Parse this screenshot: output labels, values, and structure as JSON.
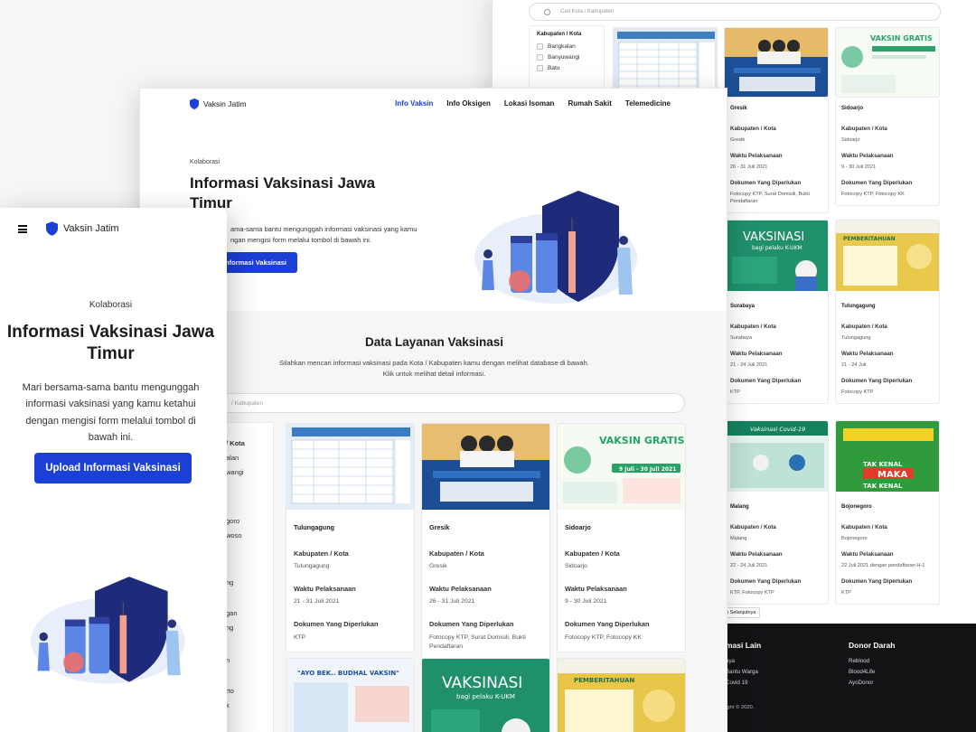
{
  "brand": {
    "name": "Vaksin Jatim",
    "color": "#1c3fd6"
  },
  "nav": {
    "items": [
      {
        "label": "Info Vaksin",
        "active": true
      },
      {
        "label": "Info Oksigen",
        "active": false
      },
      {
        "label": "Lokasi Isoman",
        "active": false
      },
      {
        "label": "Rumah Sakit",
        "active": false
      },
      {
        "label": "Telemedicine",
        "active": false
      }
    ]
  },
  "hero": {
    "kicker": "Kolaborasi",
    "title": "Informasi Vaksinasi Jawa Timur",
    "desc_mid": "ama-sama bantu mengunggah informasi vaksinasi yang kamu\nngan mengisi form melalui tombol di bawah ini.",
    "cta_mid": "Informasi Vaksinasi",
    "desc_full": "Mari bersama-sama bantu mengunggah informasi vaksinasi yang kamu ketahui dengan mengisi form melalui tombol di bawah ini.",
    "cta_full": "Upload Informasi Vaksinasi"
  },
  "section": {
    "title": "Data Layanan Vaksinasi",
    "desc": "Silahkan mencari informasi vaksinasi pada Kota / Kabupaten kamu dengan melihat database di bawah. Klik untuk melihat detail informasi.",
    "search_placeholder_mid": "/ Kabupaten",
    "search_placeholder_back": "Cari Kota / Kabupaten"
  },
  "labels": {
    "kab": "Kabupaten / Kota",
    "waktu": "Waktu Pelaksanaan",
    "dokumen": "Dokumen Yang Diperlukan"
  },
  "filter": {
    "title": "Kabupaten / Kota",
    "items": [
      "Bangkalan",
      "Banyuwangi",
      "Batu"
    ],
    "mid_fragments": [
      "/ Kota",
      "alan",
      "wangi",
      "goro",
      "woso",
      "ng",
      "gan",
      "ng",
      "n",
      "rto",
      "k"
    ]
  },
  "cards_mid": [
    {
      "city": "Tulungagung",
      "kab": "Tulungagung",
      "waktu": "21 - 31 Juli 2021",
      "dokumen": "KTP"
    },
    {
      "city": "Gresik",
      "kab": "Gresik",
      "waktu": "26 - 31 Juli 2021",
      "dokumen": "Fotocopy KTP, Surat Domisili, Bukti Pendaftaran"
    },
    {
      "city": "Sidoarjo",
      "kab": "Sidoarjo",
      "waktu": "9 - 30 Juli 2021",
      "dokumen": "Fotocopy KTP, Fotocopy KK"
    }
  ],
  "cards_back": [
    {
      "city": "Gresik",
      "kab": "Gresik",
      "waktu": "26 - 31 Juli 2021",
      "dokumen": "Fotocopy KTP, Surat Domisili, Bukti Pendaftaran"
    },
    {
      "city": "Sidoarjo",
      "kab": "Sidoarjo",
      "waktu": "9 - 30 Juli 2021",
      "dokumen": "Fotocopy KTP, Fotocopy KK"
    },
    {
      "city": "Surabaya",
      "kab": "Surabaya",
      "waktu": "21 - 24 Juli 2021",
      "dokumen": "KTP"
    },
    {
      "city": "Tulungagung",
      "kab": "Tulungagung",
      "waktu": "21 - 24 Juli",
      "dokumen": "Fotocopy KTP"
    },
    {
      "city": "Malang",
      "kab": "Malang",
      "waktu": "22 - 24 Juli 2021",
      "dokumen": "KTP, Fotocopy KTP"
    },
    {
      "city": "Bojonegoro",
      "kab": "Bojonegoro",
      "waktu": "22 Juli 2021 dengan pendaftaran H-1",
      "dokumen": "KTP"
    }
  ],
  "poster_text": {
    "vaksinasi": "VAKSINASI",
    "vaksinasi_sub": "bagi pelaku K-UKM",
    "vaksin_gratis": "VAKSIN GRATIS",
    "vaksin_gratis_date": "9 Juli - 30 Juli 2021",
    "pemberitahuan": "PEMBERITAHUAN",
    "ayo": "\"AYO BEK.. BUDHAL VAKSIN\"",
    "vaksinasi_covid": "Vaksinasi Covid-19",
    "tak_kenal": "TAK KENAL",
    "maka": "MAKA",
    "tak_kenal2": "TAK KENAL"
  },
  "pagination": {
    "next": "an Selanjutnya"
  },
  "footer": {
    "col1": {
      "heading": "masi Lain",
      "links": [
        "aya",
        "Bantu Warga",
        "Covid 19"
      ]
    },
    "col2": {
      "heading": "Donor Darah",
      "links": [
        "Reblood",
        "Blood4Life",
        "AyoDonor"
      ]
    },
    "copyright": "ight © 2020."
  }
}
